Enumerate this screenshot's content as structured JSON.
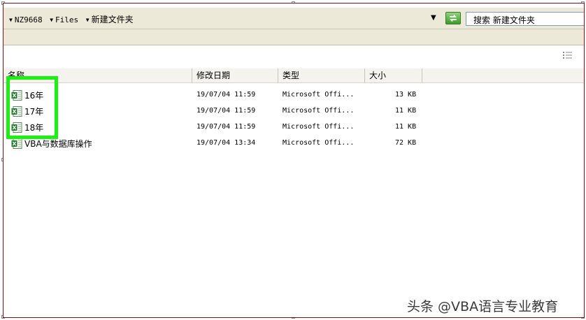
{
  "address": {
    "crumbs": [
      "NZ9668",
      "Files",
      "新建文件夹"
    ],
    "search_label": "搜索 新建文件夹"
  },
  "columns": {
    "name": "名称",
    "modified": "修改日期",
    "type": "类型",
    "size": "大小"
  },
  "files": [
    {
      "name": "16年",
      "modified": "19/07/04 11:59",
      "type": "Microsoft Offi...",
      "size": "13 KB"
    },
    {
      "name": "17年",
      "modified": "19/07/04 11:59",
      "type": "Microsoft Offi...",
      "size": "11 KB"
    },
    {
      "name": "18年",
      "modified": "19/07/04 11:59",
      "type": "Microsoft Offi...",
      "size": "11 KB"
    },
    {
      "name": "VBA与数据库操作",
      "modified": "19/07/04 13:34",
      "type": "Microsoft Offi...",
      "size": "72 KB"
    }
  ],
  "watermark": "头条 @VBA语言专业教育",
  "colors": {
    "highlight": "#1bf20f",
    "frame": "#8b0d13",
    "excel_icon": "#1f7a2e"
  },
  "icons": {
    "file": "excel-file-icon",
    "go": "refresh-go-icon",
    "view": "details-view-icon"
  }
}
